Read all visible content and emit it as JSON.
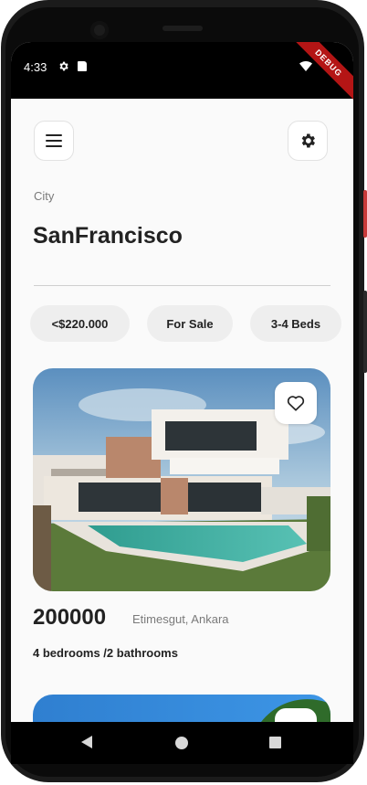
{
  "status_bar": {
    "time": "4:33",
    "debug_banner": "DEBUG"
  },
  "header": {
    "menu_icon": "hamburger-menu-icon",
    "settings_icon": "gear-icon"
  },
  "location": {
    "label": "City",
    "city": "SanFrancisco"
  },
  "filters": [
    {
      "label": "<$220.000"
    },
    {
      "label": "For Sale"
    },
    {
      "label": "3-4 Beds"
    }
  ],
  "listings": [
    {
      "price": "200000",
      "location": "Etimesgut, Ankara",
      "details": "4 bedrooms /2 bathrooms",
      "favorite_icon": "heart-outline-icon"
    }
  ],
  "nav_bar": {
    "back_icon": "back-triangle-icon",
    "home_icon": "home-circle-icon",
    "recents_icon": "recents-square-icon"
  },
  "colors": {
    "background": "#fafafa",
    "chip": "#eeeeee",
    "text": "#222222",
    "muted": "#7a7a7a",
    "debug": "#b41515"
  }
}
